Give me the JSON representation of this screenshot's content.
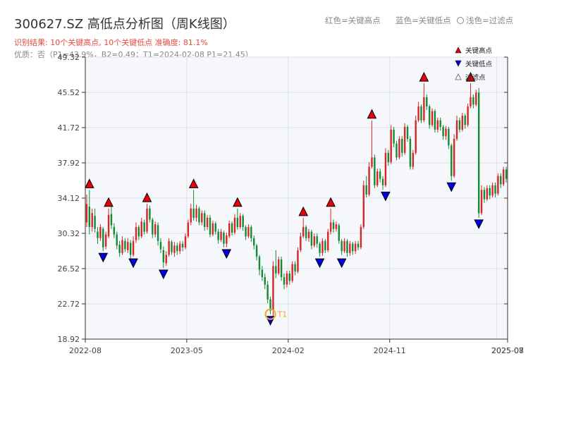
{
  "header": {
    "title": "300627.SZ 高低点分析图（周K线图）",
    "result_line": "识别结果: 10个关键高点, 10个关键低点   准确度: 81.1%",
    "quality_line": "优质：否（P1=43.9%，B2=0.49；T1=2024-02-08 P1=21.45）",
    "legend_red": "红色=关键高点",
    "legend_blue": "蓝色=关键低点",
    "legend_light": "浅色=过滤点"
  },
  "colors": {
    "up": "#d62728",
    "down": "#138a36",
    "high_marker": "#e8000b",
    "low_marker": "#0000e0",
    "t1_marker": "#f5a623",
    "plot_bg": "#f5f7fa",
    "grid": "#dde2ea"
  },
  "chart_data": {
    "type": "candlestick",
    "title": "300627.SZ 高低点分析图（周K线图）",
    "ylim": [
      18.92,
      49.32
    ],
    "y_ticks": [
      "18.92",
      "22.72",
      "26.52",
      "30.32",
      "34.12",
      "37.92",
      "41.72",
      "45.52",
      "49.32"
    ],
    "x_ticks": [
      "2022-08",
      "2023-05",
      "2024-02",
      "2024-11",
      "2025-07",
      "2025-08"
    ],
    "legend": [
      {
        "label": "关键高点",
        "kind": "high"
      },
      {
        "label": "关键低点",
        "kind": "low"
      },
      {
        "label": "过滤点",
        "kind": "filtered"
      }
    ],
    "annotation": "T1",
    "candles": [
      [
        31.5,
        33.5,
        34.5,
        31.0
      ],
      [
        33.2,
        31.0,
        35.0,
        30.2
      ],
      [
        31.0,
        32.5,
        33.0,
        30.5
      ],
      [
        32.2,
        30.8,
        33.0,
        30.4
      ],
      [
        30.5,
        29.8,
        31.0,
        29.2
      ],
      [
        29.8,
        31.0,
        31.3,
        29.5
      ],
      [
        30.8,
        28.8,
        31.0,
        28.4
      ],
      [
        28.9,
        30.2,
        30.5,
        28.6
      ],
      [
        30.0,
        32.3,
        33.0,
        29.8
      ],
      [
        32.4,
        31.2,
        33.2,
        30.8
      ],
      [
        31.0,
        30.2,
        31.4,
        29.8
      ],
      [
        30.2,
        29.0,
        30.5,
        28.6
      ],
      [
        29.1,
        28.2,
        29.5,
        27.8
      ],
      [
        28.2,
        29.6,
        30.0,
        28.0
      ],
      [
        29.5,
        28.6,
        29.8,
        28.3
      ],
      [
        28.5,
        29.4,
        29.8,
        28.2
      ],
      [
        29.3,
        28.0,
        29.6,
        27.6
      ],
      [
        28.0,
        29.5,
        30.0,
        27.8
      ],
      [
        29.6,
        31.0,
        31.5,
        29.3
      ],
      [
        31.0,
        30.0,
        31.2,
        29.6
      ],
      [
        30.0,
        31.6,
        32.0,
        29.8
      ],
      [
        31.5,
        30.5,
        31.8,
        30.2
      ],
      [
        30.5,
        33.0,
        33.5,
        30.3
      ],
      [
        33.0,
        31.8,
        33.3,
        31.5
      ],
      [
        31.8,
        30.2,
        32.0,
        29.8
      ],
      [
        30.2,
        31.3,
        31.6,
        29.9
      ],
      [
        31.2,
        29.5,
        31.5,
        29.0
      ],
      [
        29.4,
        28.6,
        29.8,
        28.2
      ],
      [
        28.5,
        27.2,
        28.9,
        26.6
      ],
      [
        27.1,
        28.0,
        28.4,
        26.8
      ],
      [
        28.0,
        29.5,
        29.8,
        27.8
      ],
      [
        29.4,
        28.3,
        29.6,
        28.0
      ],
      [
        28.2,
        29.0,
        29.4,
        27.8
      ],
      [
        29.0,
        28.4,
        29.3,
        28.0
      ],
      [
        28.4,
        29.2,
        29.5,
        28.1
      ],
      [
        29.2,
        28.8,
        29.5,
        28.4
      ],
      [
        28.8,
        30.0,
        30.3,
        28.6
      ],
      [
        30.0,
        31.5,
        31.8,
        29.8
      ],
      [
        31.5,
        33.0,
        33.5,
        31.2
      ],
      [
        33.0,
        32.0,
        35.0,
        31.7
      ],
      [
        32.0,
        33.0,
        33.4,
        31.6
      ],
      [
        33.0,
        31.5,
        33.2,
        31.2
      ],
      [
        31.5,
        32.5,
        32.8,
        31.2
      ],
      [
        32.5,
        31.0,
        32.8,
        30.6
      ],
      [
        31.0,
        32.0,
        32.3,
        30.7
      ],
      [
        32.0,
        30.2,
        32.3,
        29.9
      ],
      [
        30.2,
        31.4,
        31.7,
        30.0
      ],
      [
        31.4,
        30.5,
        31.6,
        30.2
      ],
      [
        30.5,
        29.6,
        30.8,
        29.2
      ],
      [
        29.6,
        30.5,
        30.8,
        29.4
      ],
      [
        30.4,
        29.2,
        30.6,
        28.8
      ],
      [
        29.2,
        30.1,
        30.4,
        28.8
      ],
      [
        30.0,
        31.4,
        31.7,
        29.8
      ],
      [
        31.4,
        30.4,
        31.6,
        30.1
      ],
      [
        30.4,
        32.0,
        32.4,
        30.2
      ],
      [
        32.0,
        31.0,
        33.0,
        30.7
      ],
      [
        31.0,
        32.2,
        32.5,
        30.8
      ],
      [
        32.2,
        31.0,
        32.4,
        30.6
      ],
      [
        31.0,
        30.0,
        31.2,
        29.6
      ],
      [
        30.0,
        31.0,
        31.3,
        29.8
      ],
      [
        31.0,
        29.8,
        31.2,
        29.4
      ],
      [
        29.8,
        29.0,
        30.1,
        28.6
      ],
      [
        29.0,
        27.8,
        29.2,
        27.4
      ],
      [
        27.8,
        26.4,
        28.0,
        25.8
      ],
      [
        26.4,
        25.6,
        26.8,
        25.2
      ],
      [
        25.6,
        24.8,
        26.0,
        24.3
      ],
      [
        24.8,
        23.2,
        25.2,
        22.8
      ],
      [
        23.2,
        22.0,
        23.5,
        21.6
      ],
      [
        22.0,
        26.8,
        27.3,
        21.4
      ],
      [
        26.8,
        26.0,
        28.5,
        25.5
      ],
      [
        26.0,
        27.5,
        27.8,
        25.8
      ],
      [
        27.5,
        25.6,
        27.8,
        25.2
      ],
      [
        25.6,
        24.8,
        26.0,
        24.3
      ],
      [
        24.8,
        26.0,
        26.3,
        24.5
      ],
      [
        26.0,
        25.2,
        26.3,
        24.8
      ],
      [
        25.2,
        27.0,
        27.3,
        25.0
      ],
      [
        27.0,
        26.2,
        27.3,
        25.8
      ],
      [
        26.2,
        28.5,
        28.8,
        26.0
      ],
      [
        28.5,
        30.0,
        30.4,
        28.3
      ],
      [
        30.0,
        31.0,
        32.0,
        29.8
      ],
      [
        31.0,
        29.8,
        31.2,
        29.5
      ],
      [
        29.8,
        30.5,
        30.8,
        29.4
      ],
      [
        30.5,
        29.0,
        30.7,
        28.6
      ],
      [
        29.0,
        30.0,
        30.3,
        28.8
      ],
      [
        30.0,
        29.2,
        30.3,
        28.8
      ],
      [
        29.2,
        28.2,
        29.4,
        27.8
      ],
      [
        28.2,
        29.5,
        29.8,
        27.9
      ],
      [
        29.5,
        28.5,
        29.7,
        28.2
      ],
      [
        28.5,
        30.5,
        30.8,
        28.3
      ],
      [
        30.5,
        31.5,
        33.0,
        30.2
      ],
      [
        31.5,
        30.8,
        31.8,
        30.4
      ],
      [
        30.8,
        31.3,
        31.6,
        30.5
      ],
      [
        31.2,
        29.5,
        31.4,
        29.2
      ],
      [
        29.5,
        28.4,
        29.7,
        28.0
      ],
      [
        28.4,
        29.5,
        29.8,
        28.2
      ],
      [
        29.5,
        28.2,
        29.7,
        27.8
      ],
      [
        28.2,
        29.2,
        29.5,
        27.9
      ],
      [
        29.2,
        28.4,
        29.4,
        28.0
      ],
      [
        28.4,
        29.2,
        29.5,
        28.1
      ],
      [
        29.2,
        28.8,
        29.5,
        28.5
      ],
      [
        28.8,
        31.0,
        31.3,
        28.6
      ],
      [
        31.0,
        35.5,
        36.0,
        30.8
      ],
      [
        35.5,
        34.5,
        36.5,
        34.2
      ],
      [
        34.5,
        37.5,
        38.0,
        34.3
      ],
      [
        37.5,
        38.5,
        42.5,
        37.3
      ],
      [
        38.5,
        35.5,
        38.8,
        35.2
      ],
      [
        35.5,
        37.0,
        37.3,
        35.3
      ],
      [
        37.0,
        36.2,
        37.3,
        35.8
      ],
      [
        36.2,
        35.5,
        36.5,
        35.0
      ],
      [
        35.5,
        39.0,
        39.5,
        35.3
      ],
      [
        39.0,
        38.0,
        39.3,
        37.6
      ],
      [
        38.0,
        41.5,
        42.0,
        37.8
      ],
      [
        41.5,
        40.0,
        41.8,
        39.6
      ],
      [
        40.0,
        38.5,
        40.3,
        38.2
      ],
      [
        38.5,
        40.5,
        40.8,
        38.3
      ],
      [
        40.5,
        39.0,
        40.8,
        38.6
      ],
      [
        39.0,
        41.8,
        42.2,
        38.8
      ],
      [
        41.8,
        40.5,
        42.0,
        40.2
      ],
      [
        40.5,
        37.5,
        40.8,
        37.2
      ],
      [
        37.5,
        39.0,
        39.3,
        37.2
      ],
      [
        39.0,
        42.5,
        43.0,
        38.8
      ],
      [
        42.5,
        44.0,
        44.5,
        42.3
      ],
      [
        44.0,
        42.5,
        44.2,
        42.2
      ],
      [
        42.5,
        45.0,
        46.5,
        42.3
      ],
      [
        45.0,
        44.0,
        45.3,
        43.6
      ],
      [
        44.0,
        42.0,
        44.2,
        41.6
      ],
      [
        42.0,
        43.5,
        43.8,
        41.8
      ],
      [
        43.5,
        41.5,
        43.7,
        41.2
      ],
      [
        41.5,
        42.5,
        42.8,
        41.2
      ],
      [
        42.5,
        41.8,
        42.8,
        41.4
      ],
      [
        41.8,
        40.8,
        42.0,
        40.4
      ],
      [
        40.8,
        41.6,
        41.9,
        40.4
      ],
      [
        41.6,
        39.8,
        41.8,
        39.4
      ],
      [
        39.8,
        36.5,
        40.0,
        36.0
      ],
      [
        36.5,
        40.5,
        41.0,
        36.3
      ],
      [
        40.5,
        42.5,
        43.0,
        40.3
      ],
      [
        42.5,
        41.5,
        42.8,
        41.2
      ],
      [
        41.5,
        43.0,
        43.3,
        41.3
      ],
      [
        43.0,
        42.0,
        43.2,
        41.6
      ],
      [
        42.0,
        44.0,
        44.3,
        41.8
      ],
      [
        44.0,
        45.0,
        46.5,
        43.8
      ],
      [
        45.0,
        44.2,
        45.3,
        43.8
      ],
      [
        44.2,
        45.5,
        45.8,
        44.0
      ],
      [
        45.5,
        32.5,
        46.0,
        32.0
      ],
      [
        32.5,
        35.0,
        35.5,
        32.3
      ],
      [
        35.0,
        34.0,
        35.3,
        33.6
      ],
      [
        34.0,
        35.2,
        35.5,
        33.8
      ],
      [
        35.2,
        34.4,
        35.5,
        34.0
      ],
      [
        34.4,
        35.5,
        35.8,
        34.2
      ],
      [
        35.5,
        34.6,
        35.8,
        34.2
      ],
      [
        34.6,
        36.5,
        36.8,
        34.4
      ],
      [
        36.5,
        35.6,
        36.8,
        35.2
      ],
      [
        35.6,
        37.2,
        37.5,
        35.4
      ],
      [
        37.2,
        36.2,
        37.5,
        35.8
      ]
    ],
    "key_highs": [
      {
        "bar": 1,
        "price": 35.0
      },
      {
        "bar": 8,
        "price": 33.0
      },
      {
        "bar": 22,
        "price": 33.5
      },
      {
        "bar": 39,
        "price": 35.0
      },
      {
        "bar": 55,
        "price": 33.0
      },
      {
        "bar": 79,
        "price": 32.0
      },
      {
        "bar": 89,
        "price": 33.0
      },
      {
        "bar": 104,
        "price": 42.5
      },
      {
        "bar": 123,
        "price": 46.5
      },
      {
        "bar": 140,
        "price": 46.5
      }
    ],
    "key_lows": [
      {
        "bar": 6,
        "price": 28.4
      },
      {
        "bar": 17,
        "price": 27.8
      },
      {
        "bar": 28,
        "price": 26.6
      },
      {
        "bar": 51,
        "price": 28.8
      },
      {
        "bar": 67,
        "price": 21.6
      },
      {
        "bar": 85,
        "price": 27.8
      },
      {
        "bar": 93,
        "price": 27.8
      },
      {
        "bar": 109,
        "price": 35.0
      },
      {
        "bar": 133,
        "price": 36.0
      },
      {
        "bar": 143,
        "price": 32.0
      }
    ],
    "t1": {
      "bar": 67,
      "price": 21.45,
      "label": "T1"
    }
  }
}
